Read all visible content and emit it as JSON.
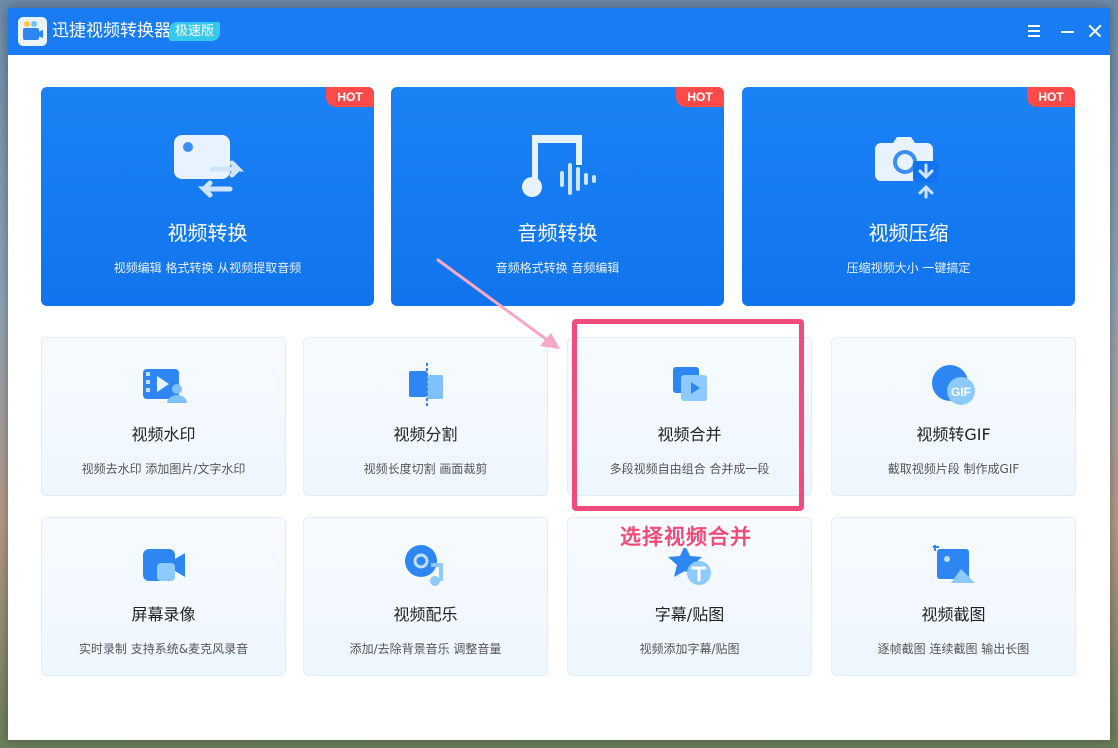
{
  "app": {
    "title": "迅捷视频转换器",
    "edition": "极速版"
  },
  "window_controls": {
    "menu_icon": "menu-icon",
    "minimize_icon": "minimize-icon",
    "close_icon": "close-icon"
  },
  "colors": {
    "brand_blue": "#1a7cf4",
    "hot_red": "#ff4a4a",
    "annotation_pink": "#f04b7a",
    "edition_badge": "#36c9f0"
  },
  "featured": [
    {
      "title": "视频转换",
      "desc": "视频编辑 格式转换 从视频提取音频",
      "badge": "HOT",
      "icon": "video-convert-icon"
    },
    {
      "title": "音频转换",
      "desc": "音频格式转换 音频编辑",
      "badge": "HOT",
      "icon": "audio-convert-icon"
    },
    {
      "title": "视频压缩",
      "desc": "压缩视频大小 一键搞定",
      "badge": "HOT",
      "icon": "video-compress-icon"
    }
  ],
  "tools": [
    {
      "title": "视频水印",
      "desc": "视频去水印 添加图片/文字水印",
      "icon": "watermark-icon"
    },
    {
      "title": "视频分割",
      "desc": "视频长度切割 画面裁剪",
      "icon": "split-icon"
    },
    {
      "title": "视频合并",
      "desc": "多段视频自由组合 合并成一段",
      "icon": "merge-icon"
    },
    {
      "title": "视频转GIF",
      "desc": "截取视频片段 制作成GIF",
      "icon": "gif-icon",
      "icon_text": "GIF"
    },
    {
      "title": "屏幕录像",
      "desc": "实时录制 支持系统&麦克风录音",
      "icon": "screen-record-icon"
    },
    {
      "title": "视频配乐",
      "desc": "添加/去除背景音乐 调整音量",
      "icon": "music-icon"
    },
    {
      "title": "字幕/贴图",
      "desc": "视频添加字幕/贴图",
      "icon": "subtitle-icon"
    },
    {
      "title": "视频截图",
      "desc": "逐帧截图 连续截图 输出长图",
      "icon": "screenshot-icon"
    }
  ],
  "annotation": {
    "text": "选择视频合并"
  }
}
